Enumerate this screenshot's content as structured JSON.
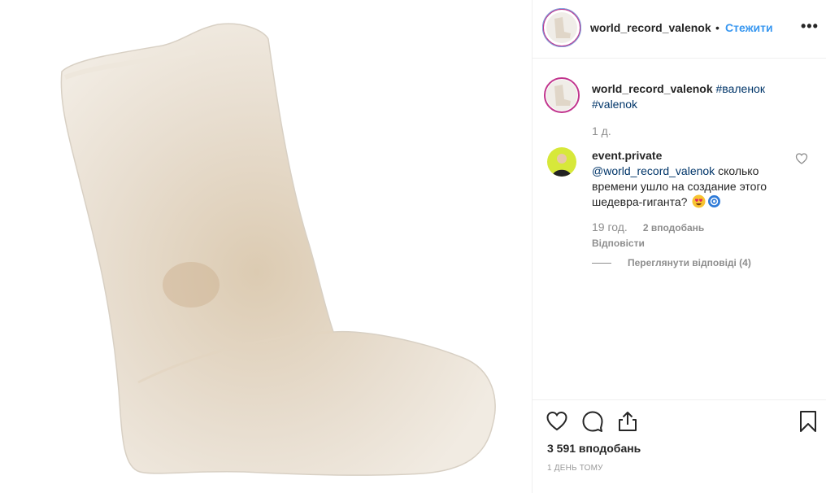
{
  "post": {
    "username": "world_record_valenok",
    "header": {
      "separator": "•",
      "follow_label": "Стежити",
      "more_label": "•••"
    },
    "caption": {
      "username": "world_record_valenok",
      "tags": [
        "#валенок",
        "#valenok"
      ],
      "time": "1 д."
    },
    "comment": {
      "username": "event.private",
      "mention": "@world_record_valenok",
      "text": "сколько времени ушло на создание этого шедевра-гиганта?",
      "time": "19 год.",
      "likes": "2 вподобань",
      "reply_label": "Відповісти",
      "view_replies_label": "Переглянути відповіді (4)"
    },
    "actions": {
      "icons": [
        "heart-icon",
        "comment-icon",
        "share-icon",
        "bookmark-icon"
      ],
      "likes_count": "3 591 вподобань",
      "posted_time": "1 ДЕНЬ ТОМУ"
    },
    "colors": {
      "link": "#3897f0",
      "hashtag": "#003569",
      "muted": "#8e8e8e",
      "ring": "#c1358d"
    }
  }
}
